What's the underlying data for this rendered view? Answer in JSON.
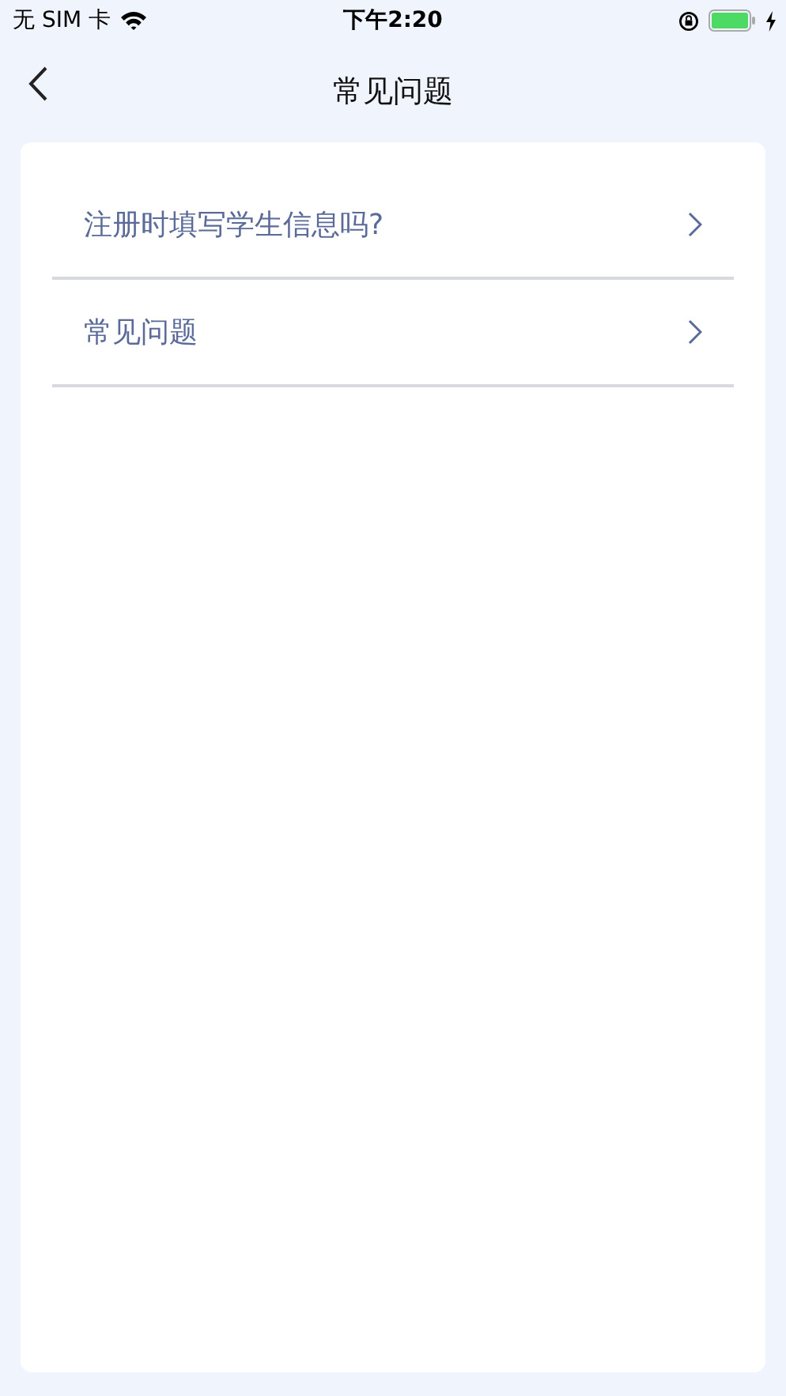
{
  "status_bar": {
    "carrier": "无 SIM 卡",
    "time": "下午2:20"
  },
  "nav": {
    "title": "常见问题"
  },
  "items": [
    {
      "label": "注册时填写学生信息吗?"
    },
    {
      "label": "常见问题"
    }
  ]
}
